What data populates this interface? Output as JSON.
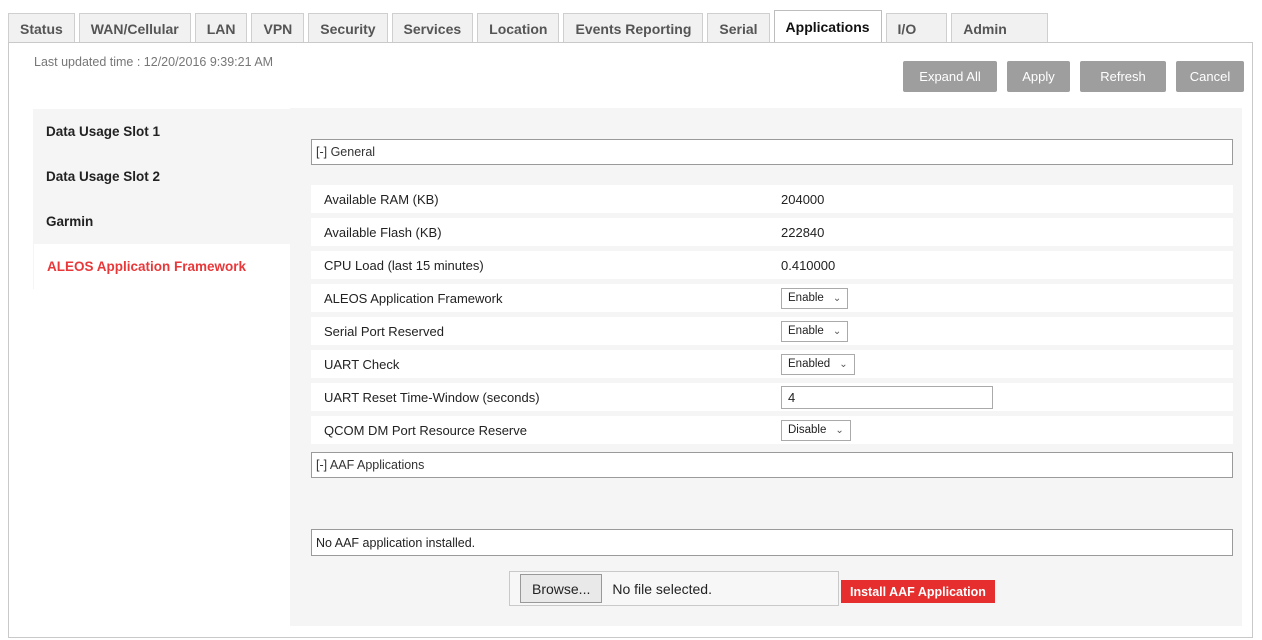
{
  "tabs": [
    {
      "label": "Status"
    },
    {
      "label": "WAN/Cellular"
    },
    {
      "label": "LAN"
    },
    {
      "label": "VPN"
    },
    {
      "label": "Security"
    },
    {
      "label": "Services"
    },
    {
      "label": "Location"
    },
    {
      "label": "Events Reporting"
    },
    {
      "label": "Serial"
    },
    {
      "label": "Applications",
      "active": true
    },
    {
      "label": "I/O"
    },
    {
      "label": "Admin"
    }
  ],
  "header": {
    "last_updated": "Last updated time : 12/20/2016 9:39:21 AM"
  },
  "toolbar": {
    "expand_all": "Expand All",
    "apply": "Apply",
    "refresh": "Refresh",
    "cancel": "Cancel"
  },
  "sidebar": {
    "items": [
      {
        "label": "Data Usage Slot 1"
      },
      {
        "label": "Data Usage Slot 2"
      },
      {
        "label": "Garmin"
      },
      {
        "label": "ALEOS Application Framework",
        "active": true
      }
    ]
  },
  "general": {
    "header": "[-] General",
    "rows": [
      {
        "label": "Available RAM (KB)",
        "value": "204000"
      },
      {
        "label": "Available Flash (KB)",
        "value": "222840"
      },
      {
        "label": "CPU Load (last 15 minutes)",
        "value": "0.410000"
      },
      {
        "label": "ALEOS Application Framework",
        "value": "Enable"
      },
      {
        "label": "Serial Port Reserved",
        "value": "Enable"
      },
      {
        "label": "UART Check",
        "value": "Enabled"
      },
      {
        "label": "UART Reset Time-Window (seconds)",
        "value": "4"
      },
      {
        "label": "QCOM DM Port Resource Reserve",
        "value": "Disable"
      }
    ]
  },
  "aaf": {
    "header": "[-] AAF Applications",
    "empty_text": "No AAF application installed.",
    "browse_label": "Browse...",
    "file_status": "No file selected.",
    "install_label": "Install AAF Application"
  },
  "colors": {
    "accent": "#e8383a",
    "install_button": "#e62e2e",
    "gray_button": "#9e9e9e",
    "panel_bg": "#f5f5f5"
  },
  "icons": {
    "select_arrow": "chevron-down-icon"
  }
}
